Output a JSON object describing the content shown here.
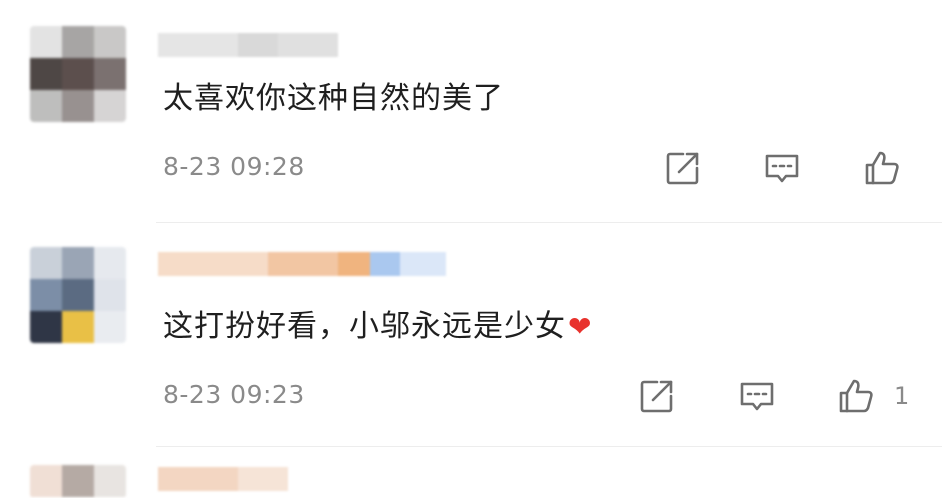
{
  "comments": [
    {
      "text": "太喜欢你这种自然的美了",
      "time": "8-23 09:28",
      "avatar_colors": [
        "#e3e3e3",
        "#a7a5a4",
        "#c9c8c7",
        "#4e4745",
        "#5c4f4d",
        "#7b7170",
        "#bebebd",
        "#989190",
        "#d6d4d4"
      ],
      "username_colors": [
        "#e5e5e5",
        "#d9d9d9",
        "#e0e0e0"
      ],
      "like_count": ""
    },
    {
      "text": "这打扮好看，小邬永远是少女",
      "emoji": "❤",
      "time": "8-23 09:23",
      "avatar_colors": [
        "#c9d0d9",
        "#9aa5b5",
        "#e6e9ee",
        "#7c8ea7",
        "#5b6b82",
        "#dfe3ea",
        "#2f3646",
        "#e9c046",
        "#e9ecf0"
      ],
      "username_colors": [
        "#f6dcc8",
        "#f2c6a3",
        "#f0b47f",
        "#aac8ef",
        "#dbe7f8"
      ],
      "like_count": "1"
    },
    {
      "avatar_colors": [
        "#f0dfd5",
        "#b5aaa4",
        "#e8e4e1"
      ],
      "username_colors": [
        "#f3d6c2",
        "#f6e4d7"
      ]
    }
  ],
  "actions": {
    "share_icon": "share-icon",
    "comment_icon": "comment-icon",
    "like_icon": "like-icon"
  }
}
